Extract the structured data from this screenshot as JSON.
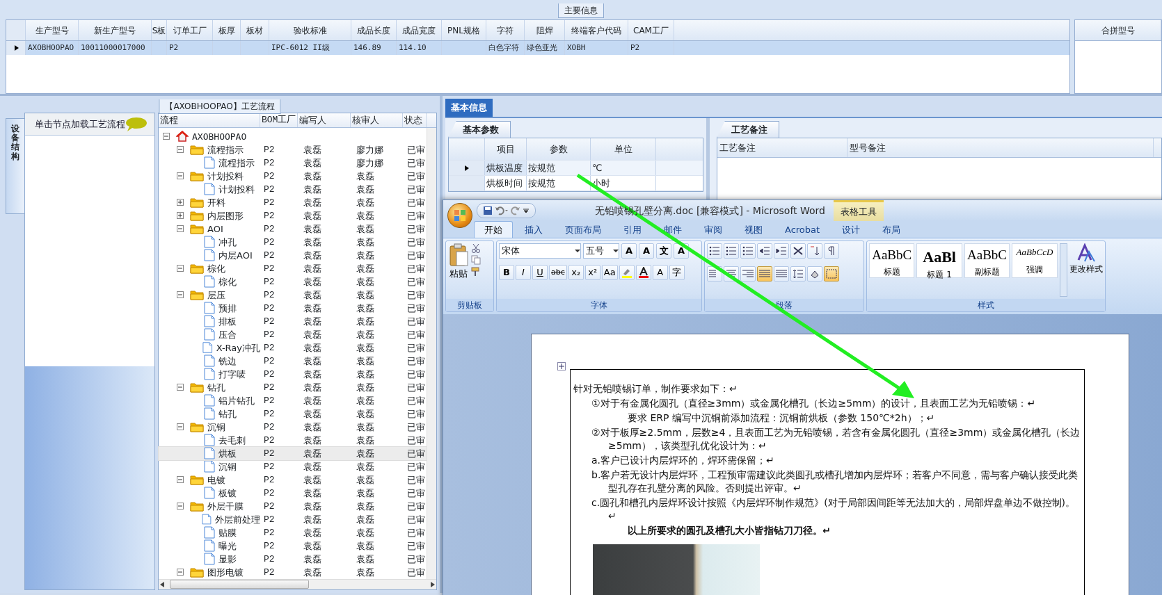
{
  "main_panel": {
    "title": "主要信息",
    "columns": [
      "生产型号",
      "新生产型号",
      "S板",
      "订单工厂",
      "板厚",
      "板材",
      "验收标准",
      "成品长度",
      "成品宽度",
      "PNL规格",
      "字符",
      "阻焊",
      "终端客户代码",
      "CAM工厂"
    ],
    "rows": [
      {
        "selected": true,
        "cells": [
          "AXOBHOOPAO",
          "10011000017000",
          null,
          "P2",
          null,
          null,
          "IPC-6012 II级",
          "146.89",
          "114.10",
          null,
          "白色字符",
          "绿色亚光",
          "XOBH",
          "P2"
        ]
      }
    ],
    "side_columns": [
      "合拼型号"
    ]
  },
  "process_panel": {
    "title": "【AXOBHOOPAO】工艺流程",
    "side_tab": "设备结构",
    "hint": "单击节点加载工艺流程",
    "columns": [
      "流程",
      "BOM工厂",
      "编写人",
      "核审人",
      "状态"
    ],
    "tree": [
      {
        "kind": "root",
        "label": "AXOBHOOPAO",
        "expanded": true,
        "selected": false,
        "children": [
          {
            "kind": "folder",
            "label": "流程指示",
            "bom": "P2",
            "writer": "袁磊",
            "reviewer": "廖力娜",
            "status": "已审",
            "expanded": true,
            "selected": false,
            "children": [
              {
                "kind": "doc",
                "label": "流程指示",
                "bom": "P2",
                "writer": "袁磊",
                "reviewer": "廖力娜",
                "status": "已审",
                "selected": false
              }
            ]
          },
          {
            "kind": "folder",
            "label": "计划投料",
            "bom": "P2",
            "writer": "袁磊",
            "reviewer": "袁磊",
            "status": "已审",
            "expanded": true,
            "selected": false,
            "children": [
              {
                "kind": "doc",
                "label": "计划投料",
                "bom": "P2",
                "writer": "袁磊",
                "reviewer": "袁磊",
                "status": "已审",
                "selected": false
              }
            ]
          },
          {
            "kind": "folder",
            "label": "开料",
            "bom": "P2",
            "writer": "袁磊",
            "reviewer": "袁磊",
            "status": "已审",
            "expanded": false,
            "selected": false
          },
          {
            "kind": "folder",
            "label": "内层图形",
            "bom": "P2",
            "writer": "袁磊",
            "reviewer": "袁磊",
            "status": "已审",
            "expanded": false,
            "selected": false
          },
          {
            "kind": "folder",
            "label": "AOI",
            "bom": "P2",
            "writer": "袁磊",
            "reviewer": "袁磊",
            "status": "已审",
            "expanded": true,
            "selected": false,
            "children": [
              {
                "kind": "doc",
                "label": "冲孔",
                "bom": "P2",
                "writer": "袁磊",
                "reviewer": "袁磊",
                "status": "已审",
                "selected": false
              },
              {
                "kind": "doc",
                "label": "内层AOI",
                "bom": "P2",
                "writer": "袁磊",
                "reviewer": "袁磊",
                "status": "已审",
                "selected": false
              }
            ]
          },
          {
            "kind": "folder",
            "label": "棕化",
            "bom": "P2",
            "writer": "袁磊",
            "reviewer": "袁磊",
            "status": "已审",
            "expanded": true,
            "selected": false,
            "children": [
              {
                "kind": "doc",
                "label": "棕化",
                "bom": "P2",
                "writer": "袁磊",
                "reviewer": "袁磊",
                "status": "已审",
                "selected": false
              }
            ]
          },
          {
            "kind": "folder",
            "label": "层压",
            "bom": "P2",
            "writer": "袁磊",
            "reviewer": "袁磊",
            "status": "已审",
            "expanded": true,
            "selected": false,
            "children": [
              {
                "kind": "doc",
                "label": "预排",
                "bom": "P2",
                "writer": "袁磊",
                "reviewer": "袁磊",
                "status": "已审",
                "selected": false
              },
              {
                "kind": "doc",
                "label": "排板",
                "bom": "P2",
                "writer": "袁磊",
                "reviewer": "袁磊",
                "status": "已审",
                "selected": false
              },
              {
                "kind": "doc",
                "label": "压合",
                "bom": "P2",
                "writer": "袁磊",
                "reviewer": "袁磊",
                "status": "已审",
                "selected": false
              },
              {
                "kind": "doc",
                "label": "X-Ray冲孔",
                "bom": "P2",
                "writer": "袁磊",
                "reviewer": "袁磊",
                "status": "已审",
                "selected": false
              },
              {
                "kind": "doc",
                "label": "铣边",
                "bom": "P2",
                "writer": "袁磊",
                "reviewer": "袁磊",
                "status": "已审",
                "selected": false
              },
              {
                "kind": "doc",
                "label": "打字唛",
                "bom": "P2",
                "writer": "袁磊",
                "reviewer": "袁磊",
                "status": "已审",
                "selected": false
              }
            ]
          },
          {
            "kind": "folder",
            "label": "钻孔",
            "bom": "P2",
            "writer": "袁磊",
            "reviewer": "袁磊",
            "status": "已审",
            "expanded": true,
            "selected": false,
            "children": [
              {
                "kind": "doc",
                "label": "铝片钻孔",
                "bom": "P2",
                "writer": "袁磊",
                "reviewer": "袁磊",
                "status": "已审",
                "selected": false
              },
              {
                "kind": "doc",
                "label": "钻孔",
                "bom": "P2",
                "writer": "袁磊",
                "reviewer": "袁磊",
                "status": "已审",
                "selected": false
              }
            ]
          },
          {
            "kind": "folder",
            "label": "沉铜",
            "bom": "P2",
            "writer": "袁磊",
            "reviewer": "袁磊",
            "status": "已审",
            "expanded": true,
            "selected": false,
            "children": [
              {
                "kind": "doc",
                "label": "去毛刺",
                "bom": "P2",
                "writer": "袁磊",
                "reviewer": "袁磊",
                "status": "已审",
                "selected": false
              },
              {
                "kind": "doc",
                "label": "烘板",
                "bom": "P2",
                "writer": "袁磊",
                "reviewer": "袁磊",
                "status": "已审",
                "selected": true
              },
              {
                "kind": "doc",
                "label": "沉铜",
                "bom": "P2",
                "writer": "袁磊",
                "reviewer": "袁磊",
                "status": "已审",
                "selected": false
              }
            ]
          },
          {
            "kind": "folder",
            "label": "电镀",
            "bom": "P2",
            "writer": "袁磊",
            "reviewer": "袁磊",
            "status": "已审",
            "expanded": true,
            "selected": false,
            "children": [
              {
                "kind": "doc",
                "label": "板镀",
                "bom": "P2",
                "writer": "袁磊",
                "reviewer": "袁磊",
                "status": "已审",
                "selected": false
              }
            ]
          },
          {
            "kind": "folder",
            "label": "外层干膜",
            "bom": "P2",
            "writer": "袁磊",
            "reviewer": "袁磊",
            "status": "已审",
            "expanded": true,
            "selected": false,
            "children": [
              {
                "kind": "doc",
                "label": "外层前处理",
                "bom": "P2",
                "writer": "袁磊",
                "reviewer": "袁磊",
                "status": "已审",
                "selected": false
              },
              {
                "kind": "doc",
                "label": "贴膜",
                "bom": "P2",
                "writer": "袁磊",
                "reviewer": "袁磊",
                "status": "已审",
                "selected": false
              },
              {
                "kind": "doc",
                "label": "曝光",
                "bom": "P2",
                "writer": "袁磊",
                "reviewer": "袁磊",
                "status": "已审",
                "selected": false
              },
              {
                "kind": "doc",
                "label": "显影",
                "bom": "P2",
                "writer": "袁磊",
                "reviewer": "袁磊",
                "status": "已审",
                "selected": false
              }
            ]
          },
          {
            "kind": "folder",
            "label": "图形电镀",
            "bom": "P2",
            "writer": "袁磊",
            "reviewer": "袁磊",
            "status": "已审",
            "expanded": true,
            "selected": false
          }
        ]
      }
    ]
  },
  "info_tabs": [
    {
      "label": "基本信息",
      "selected": true
    }
  ],
  "params": {
    "tab": "基本参数",
    "columns": [
      "项目",
      "参数",
      "单位"
    ],
    "rows": [
      {
        "item": "烘板温度",
        "value": "按规范",
        "unit": "℃",
        "selected": true
      },
      {
        "item": "烘板时间",
        "value": "按规范",
        "unit": "小时",
        "selected": false
      }
    ]
  },
  "notes": {
    "tab": "工艺备注",
    "columns": [
      "工艺备注",
      "型号备注"
    ]
  },
  "word": {
    "title": "无铅喷锡孔壁分离.doc [兼容模式] - Microsoft Word",
    "context_title": "表格工具",
    "tabs": [
      {
        "label": "开始",
        "selected": true
      },
      {
        "label": "插入",
        "selected": false
      },
      {
        "label": "页面布局",
        "selected": false
      },
      {
        "label": "引用",
        "selected": false
      },
      {
        "label": "邮件",
        "selected": false
      },
      {
        "label": "审阅",
        "selected": false
      },
      {
        "label": "视图",
        "selected": false
      },
      {
        "label": "Acrobat",
        "selected": false
      },
      {
        "label": "设计",
        "selected": false
      },
      {
        "label": "布局",
        "selected": false
      }
    ],
    "paste": "粘贴",
    "font_name": "宋体",
    "font_size": "五号",
    "font_tools": [
      "A",
      "A",
      "文",
      "A"
    ],
    "format_buttons": [
      "B",
      "I",
      "U",
      "abc",
      "x₂",
      "x²",
      "Aa"
    ],
    "font_tools2": [
      "A",
      "字"
    ],
    "align_buttons": [
      {
        "selected": false
      },
      {
        "selected": false
      },
      {
        "selected": false
      },
      {
        "selected": true
      },
      {
        "selected": false
      }
    ],
    "borders_active": true,
    "styles": [
      {
        "sample": "AaBbC",
        "label": "标题"
      },
      {
        "sample": "AaBl",
        "label": "标题 1"
      },
      {
        "sample": "AaBbC",
        "label": "副标题"
      },
      {
        "sample": "AaBbCcD",
        "label": "强调"
      }
    ],
    "change_styles": "更改样式",
    "groups": [
      "剪贴板",
      "字体",
      "段落",
      "样式"
    ],
    "document": [
      {
        "kind": "plain",
        "text": "针对无铅喷锡订单，制作要求如下：↵"
      },
      {
        "kind": "item",
        "text": "①对于有金属化圆孔（直径≥3mm）或金属化槽孔（长边≥5mm）的设计，且表面工艺为无铅喷锡：↵"
      },
      {
        "kind": "sub",
        "text": "要求 ERP 编写中沉铜前添加流程：沉铜前烘板（参数 150℃*2h）；↵"
      },
      {
        "kind": "item",
        "text": "②对于板厚≥2.5mm，层数≥4，且表面工艺为无铅喷锡，若含有金属化圆孔（直径≥3mm）或金属化槽孔（长边≥5mm），该类型孔优化设计为：↵"
      },
      {
        "kind": "item",
        "text": "a.客户已设计内层焊环的，焊环需保留；↵"
      },
      {
        "kind": "item",
        "text": "b.客户若无设计内层焊环，工程预审需建议此类圆孔或槽孔增加内层焊环；若客户不同意，需与客户确认接受此类型孔存在孔壁分离的风险。否则提出评审。↵"
      },
      {
        "kind": "item",
        "text": "c.圆孔和槽孔内层焊环设计按照《内层焊环制作规范》(对于局部因间距等无法加大的，局部焊盘单边不做控制)。↵"
      },
      {
        "kind": "bold",
        "text": "以上所要求的圆孔及槽孔大小皆指钻刀刀径。↵"
      },
      {
        "kind": "photo"
      }
    ]
  }
}
